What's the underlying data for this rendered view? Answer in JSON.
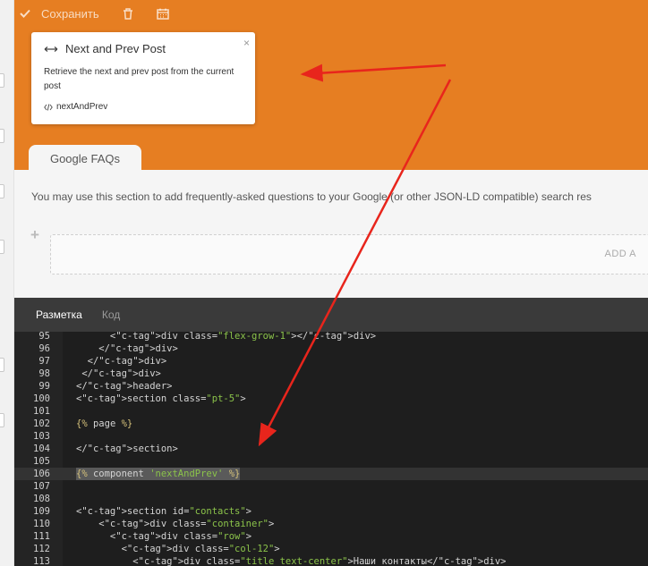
{
  "toolbar": {
    "save_label": "Сохранить"
  },
  "popover": {
    "title": "Next and Prev Post",
    "description": "Retrieve the next and prev post from the current post",
    "code": "nextAndPrev",
    "close": "×"
  },
  "tab": {
    "label": "Google FAQs"
  },
  "section": {
    "description": "You may use this section to add frequently-asked questions to your Google (or other JSON-LD compatible) search res",
    "add_label": "ADD A"
  },
  "editor": {
    "tabs": [
      {
        "label": "Разметка"
      },
      {
        "label": "Код"
      }
    ],
    "lines": [
      {
        "n": "95",
        "code": "      <div class=\"flex-grow-1\"></div>"
      },
      {
        "n": "96",
        "code": "    </div>"
      },
      {
        "n": "97",
        "code": "  </div>"
      },
      {
        "n": "98",
        "code": " </div>"
      },
      {
        "n": "99",
        "code": "</header>"
      },
      {
        "n": "100",
        "code": "<section class=\"pt-5\">"
      },
      {
        "n": "101",
        "code": ""
      },
      {
        "n": "102",
        "code": "{% page %}"
      },
      {
        "n": "103",
        "code": ""
      },
      {
        "n": "104",
        "code": "</section>"
      },
      {
        "n": "105",
        "code": ""
      },
      {
        "n": "106",
        "code": "{% component 'nextAndPrev' %}"
      },
      {
        "n": "107",
        "code": ""
      },
      {
        "n": "108",
        "code": ""
      },
      {
        "n": "109",
        "code": "<section id=\"contacts\">"
      },
      {
        "n": "110",
        "code": "    <div class=\"container\">"
      },
      {
        "n": "111",
        "code": "      <div class=\"row\">"
      },
      {
        "n": "112",
        "code": "        <div class=\"col-12\">"
      },
      {
        "n": "113",
        "code": "          <div class=\"title text-center\">Наши контакты</div>"
      }
    ]
  },
  "colors": {
    "accent": "#e67e22",
    "editor_bg": "#1e1e1e",
    "arrow": "#e8251c"
  },
  "icons": [
    "check-icon",
    "trash-icon",
    "calendar-icon",
    "arrows-horizontal-icon",
    "close-icon",
    "code-icon",
    "plus-icon"
  ]
}
